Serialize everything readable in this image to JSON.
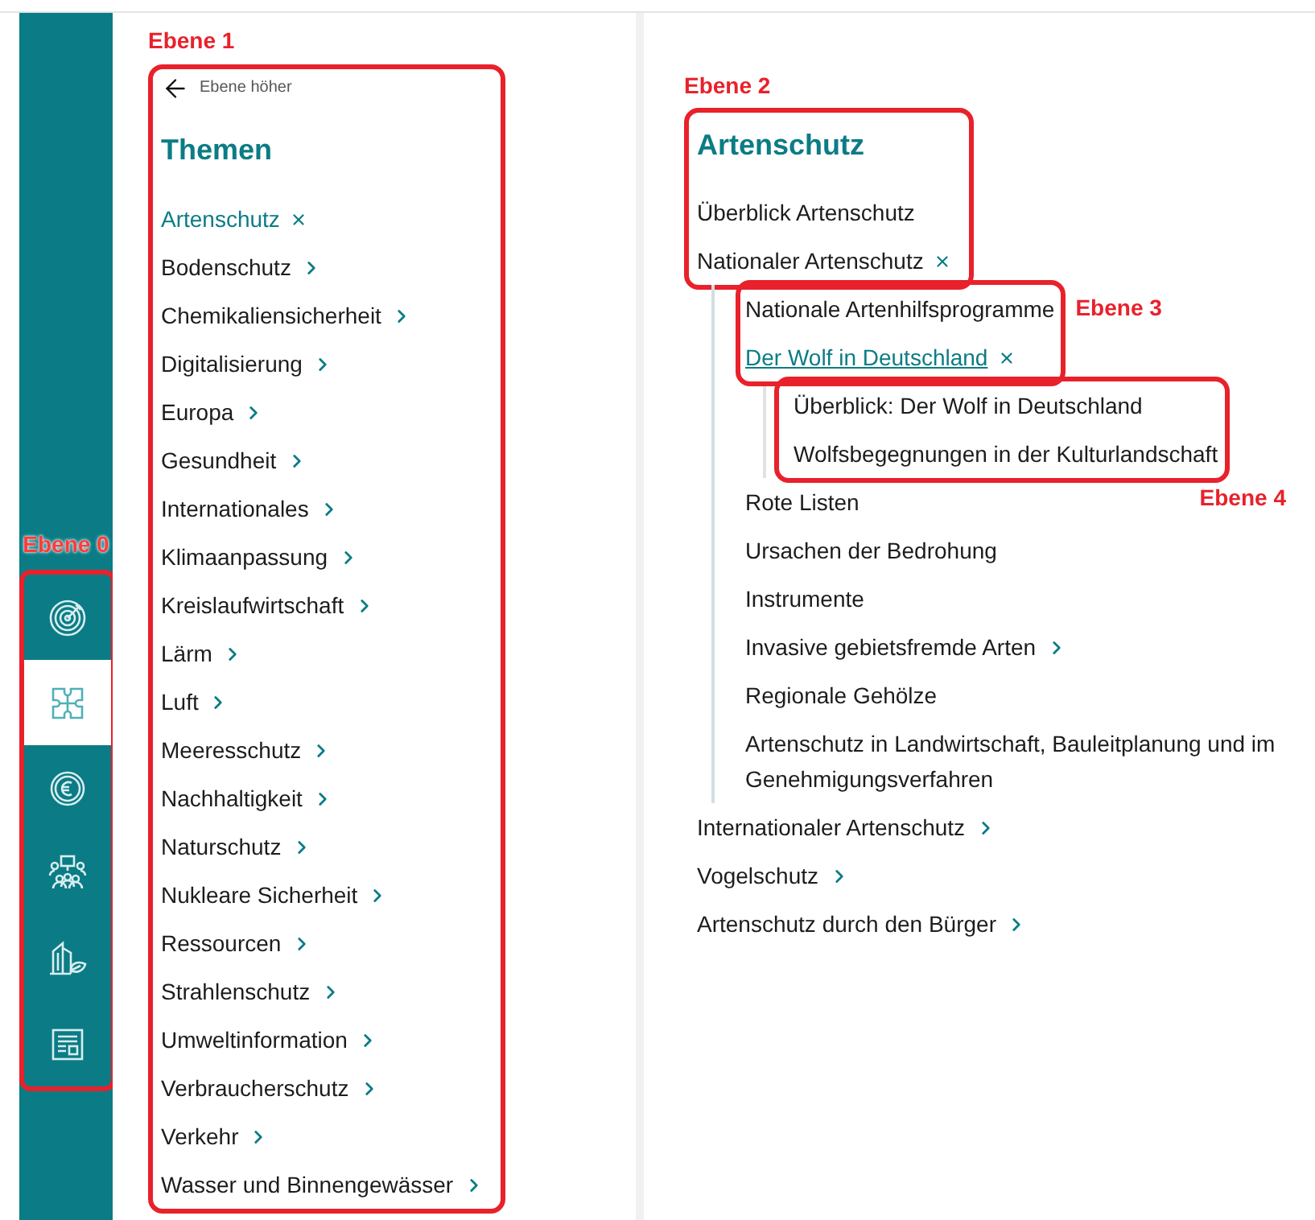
{
  "sidebar": {
    "annotation": "Ebene 0",
    "items": [
      {
        "kind": "target",
        "selected": false
      },
      {
        "kind": "puzzle",
        "selected": true
      },
      {
        "kind": "euro",
        "selected": false
      },
      {
        "kind": "meeting",
        "selected": false
      },
      {
        "kind": "building",
        "selected": false
      },
      {
        "kind": "newspaper",
        "selected": false
      }
    ]
  },
  "topics_panel": {
    "annotation": "Ebene 1",
    "back_link": "Ebene höher",
    "title": "Themen",
    "items": [
      {
        "label": "Artenschutz",
        "kind": "open",
        "selected": true
      },
      {
        "label": "Bodenschutz",
        "kind": "expandable",
        "selected": false
      },
      {
        "label": "Chemikaliensicherheit",
        "kind": "expandable",
        "selected": false
      },
      {
        "label": "Digitalisierung",
        "kind": "expandable",
        "selected": false
      },
      {
        "label": "Europa",
        "kind": "expandable",
        "selected": false
      },
      {
        "label": "Gesundheit",
        "kind": "expandable",
        "selected": false
      },
      {
        "label": "Internationales",
        "kind": "expandable",
        "selected": false
      },
      {
        "label": "Klimaanpassung",
        "kind": "expandable",
        "selected": false
      },
      {
        "label": "Kreislaufwirtschaft",
        "kind": "expandable",
        "selected": false
      },
      {
        "label": "Lärm",
        "kind": "expandable",
        "selected": false
      },
      {
        "label": "Luft",
        "kind": "expandable",
        "selected": false
      },
      {
        "label": "Meeresschutz",
        "kind": "expandable",
        "selected": false
      },
      {
        "label": "Nachhaltigkeit",
        "kind": "expandable",
        "selected": false
      },
      {
        "label": "Naturschutz",
        "kind": "expandable",
        "selected": false
      },
      {
        "label": "Nukleare Sicherheit",
        "kind": "expandable",
        "selected": false
      },
      {
        "label": "Ressourcen",
        "kind": "expandable",
        "selected": false
      },
      {
        "label": "Strahlenschutz",
        "kind": "expandable",
        "selected": false
      },
      {
        "label": "Umweltinformation",
        "kind": "expandable",
        "selected": false
      },
      {
        "label": "Verbraucherschutz",
        "kind": "expandable",
        "selected": false
      },
      {
        "label": "Verkehr",
        "kind": "expandable",
        "selected": false
      },
      {
        "label": "Wasser und Binnengewässer",
        "kind": "expandable",
        "selected": false
      }
    ]
  },
  "detail_panel": {
    "annotation": "Ebene 2",
    "title": "Artenschutz",
    "items": [
      {
        "label": "Überblick Artenschutz",
        "kind": "leaf",
        "selected": false
      },
      {
        "label": "Nationaler Artenschutz",
        "kind": "open",
        "selected": false,
        "annotation": "Ebene 3",
        "children": [
          {
            "label": "Nationale Artenhilfsprogramme",
            "kind": "leaf",
            "selected": false
          },
          {
            "label": "Der Wolf in Deutschland",
            "kind": "open",
            "selected": true,
            "annotation": "Ebene 4",
            "children": [
              {
                "label": "Überblick: Der Wolf in Deutschland",
                "kind": "leaf",
                "selected": false
              },
              {
                "label": "Wolfsbegegnungen in der Kulturlandschaft",
                "kind": "leaf",
                "selected": false
              }
            ]
          },
          {
            "label": "Rote Listen",
            "kind": "leaf",
            "selected": false
          },
          {
            "label": "Ursachen der Bedrohung",
            "kind": "leaf",
            "selected": false
          },
          {
            "label": "Instrumente",
            "kind": "leaf",
            "selected": false
          },
          {
            "label": "Invasive gebietsfremde Arten",
            "kind": "expandable",
            "selected": false
          },
          {
            "label": "Regionale Gehölze",
            "kind": "leaf",
            "selected": false
          },
          {
            "label": "Artenschutz in Landwirtschaft, Bauleitplanung und im Genehmigungsverfahren",
            "kind": "leaf",
            "selected": false
          }
        ]
      },
      {
        "label": "Internationaler Artenschutz",
        "kind": "expandable",
        "selected": false
      },
      {
        "label": "Vogelschutz",
        "kind": "expandable",
        "selected": false
      },
      {
        "label": "Artenschutz durch den Bürger",
        "kind": "expandable",
        "selected": false
      }
    ]
  }
}
